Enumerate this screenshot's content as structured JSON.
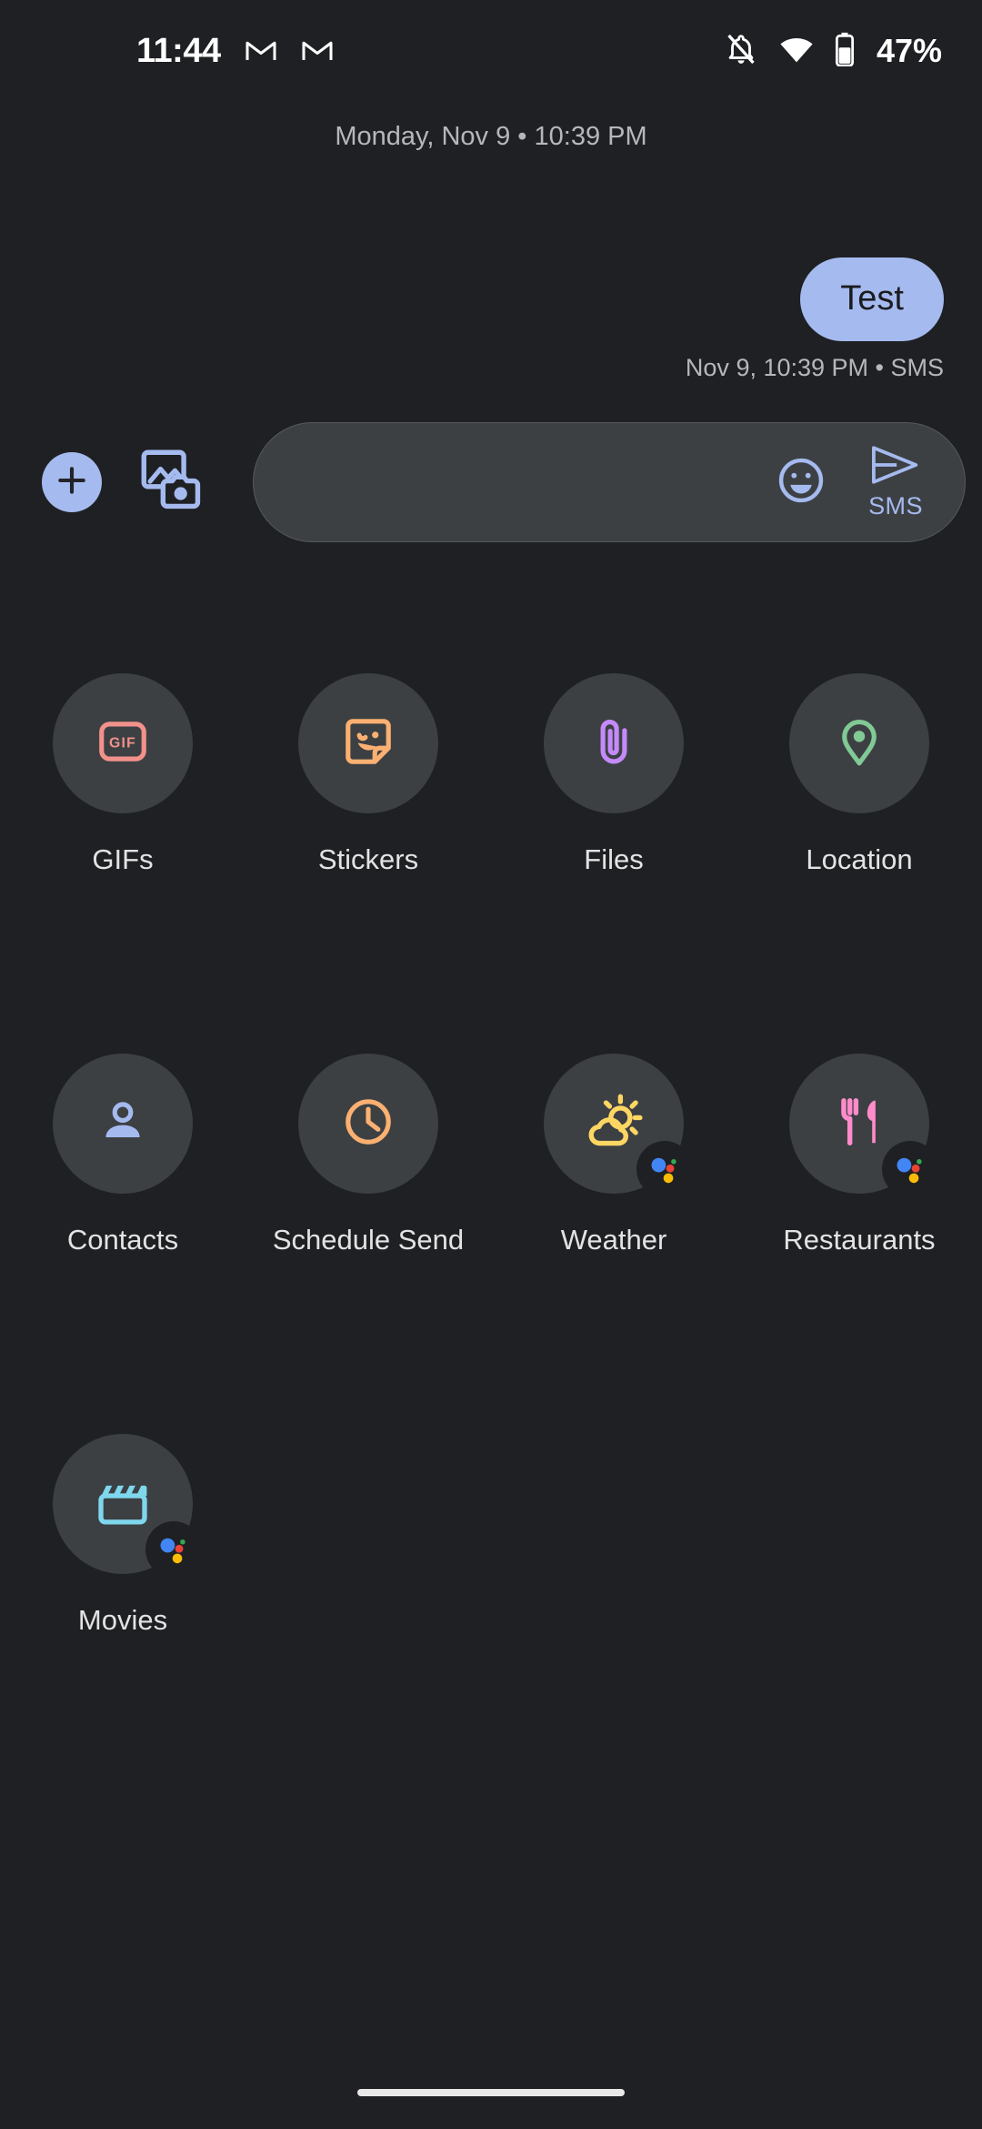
{
  "status_bar": {
    "time": "11:44",
    "battery_percent": "47%",
    "icons": [
      "gmail-icon",
      "gmail-icon",
      "notifications-off-icon",
      "wifi-icon",
      "battery-icon"
    ]
  },
  "conversation": {
    "date_separator": "Monday, Nov 9 • 10:39 PM",
    "messages": [
      {
        "text": "Test",
        "status": "Nov 9, 10:39 PM • SMS",
        "outgoing": true,
        "bubble_color": "#A5BAEF"
      }
    ]
  },
  "compose": {
    "plus_button_label": "",
    "gallery_button_label": "",
    "input_value": "",
    "input_placeholder": "",
    "emoji_button_label": "",
    "send_label": "SMS",
    "accent_color": "#A5BAEF",
    "field_bg": "#3C4043"
  },
  "attachment_grid": {
    "items": [
      {
        "label": "GIFs",
        "icon": "gif-icon",
        "color": "#F2918B",
        "assistant_badge": false
      },
      {
        "label": "Stickers",
        "icon": "sticker-icon",
        "color": "#FBB072",
        "assistant_badge": false
      },
      {
        "label": "Files",
        "icon": "paperclip-icon",
        "color": "#C58AF9",
        "assistant_badge": false
      },
      {
        "label": "Location",
        "icon": "location-pin-icon",
        "color": "#81C995",
        "assistant_badge": false
      },
      {
        "label": "Contacts",
        "icon": "person-icon",
        "color": "#A5BAEF",
        "assistant_badge": false
      },
      {
        "label": "Schedule Send",
        "icon": "clock-icon",
        "color": "#FBB072",
        "assistant_badge": false
      },
      {
        "label": "Weather",
        "icon": "weather-sun-cloud-icon",
        "color": "#FDD663",
        "assistant_badge": true
      },
      {
        "label": "Restaurants",
        "icon": "restaurant-icon",
        "color": "#FF8BCB",
        "assistant_badge": true
      },
      {
        "label": "Movies",
        "icon": "movie-clapper-icon",
        "color": "#7FD7EE",
        "assistant_badge": true
      }
    ]
  },
  "theme": {
    "background": "#1F2023",
    "circle_bg": "#3C4043",
    "text_primary": "#E3E3E3",
    "text_secondary": "#B5B8BB"
  }
}
